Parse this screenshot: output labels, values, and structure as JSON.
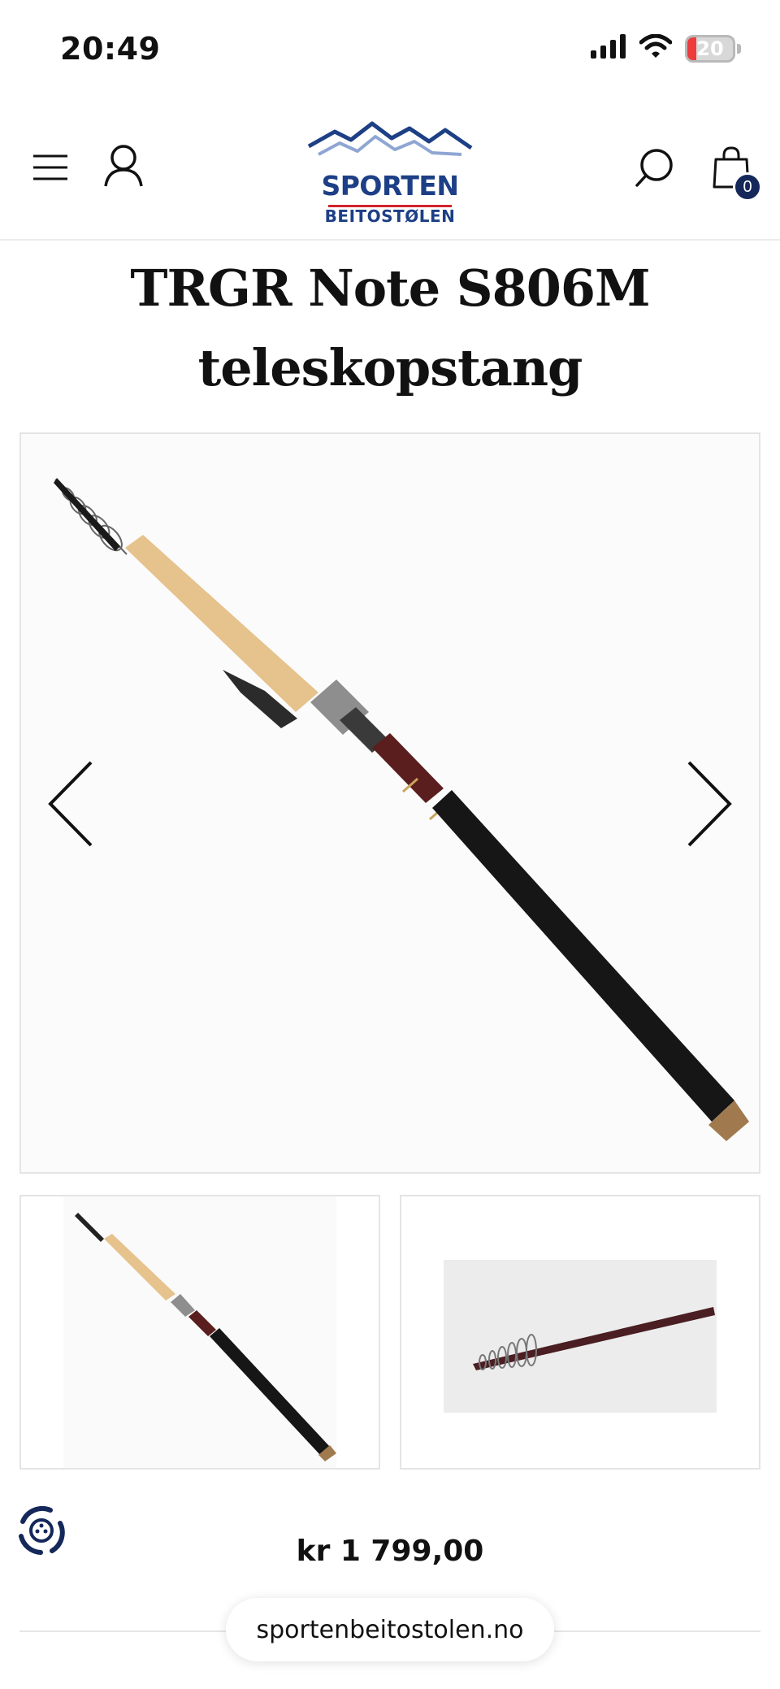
{
  "status_bar": {
    "time": "20:49",
    "battery_level": "20",
    "battery_fraction": 0.2,
    "icons": [
      "signal-icon",
      "wifi-icon",
      "battery-icon"
    ]
  },
  "header": {
    "logo_main": "SPORTEN",
    "logo_sub": "BEITOSTØLEN",
    "cart_count": "0",
    "icons": [
      "menu-icon",
      "account-icon",
      "search-icon",
      "cart-icon"
    ]
  },
  "product": {
    "title": "TRGR Note S806M teleskopstang",
    "price": "kr 1 799,00",
    "image_count": 2
  },
  "browser": {
    "url": "sportenbeitostolen.no"
  },
  "colors": {
    "brand_blue": "#1d3f86",
    "brand_red": "#d2232a",
    "badge_bg": "#14285a",
    "battery_low": "#ef3b3b"
  }
}
